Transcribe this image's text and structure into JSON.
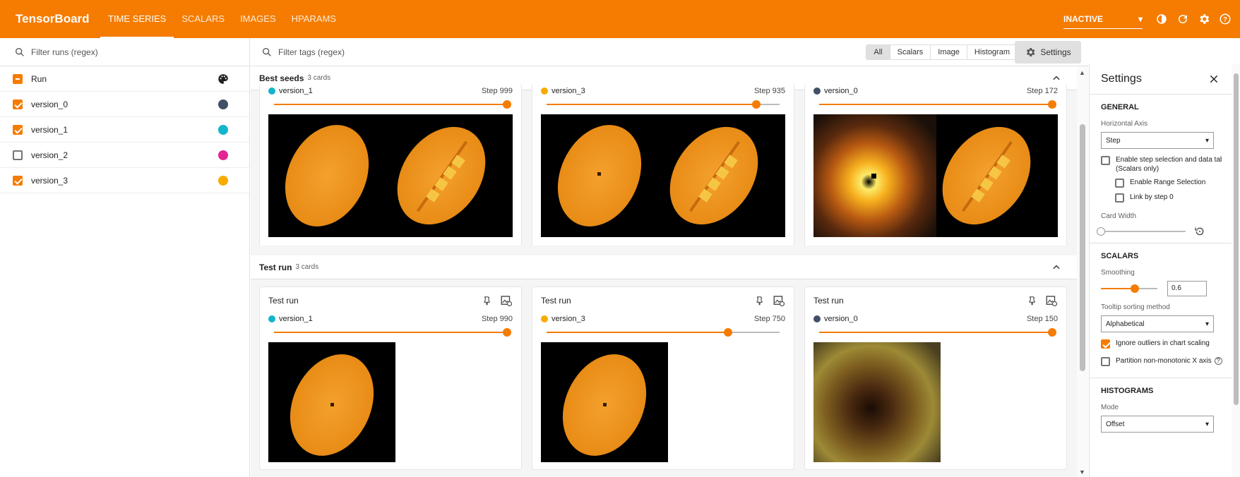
{
  "app": {
    "brand": "TensorBoard"
  },
  "nav": {
    "tabs": [
      "TIME SERIES",
      "SCALARS",
      "IMAGES",
      "HPARAMS"
    ],
    "active": "TIME SERIES"
  },
  "top": {
    "reload_state": "INACTIVE"
  },
  "runs": {
    "filter_placeholder": "Filter runs (regex)",
    "header": "Run",
    "items": [
      {
        "name": "version_0",
        "checked": true,
        "color": "#425066"
      },
      {
        "name": "version_1",
        "checked": true,
        "color": "#12b5cb"
      },
      {
        "name": "version_2",
        "checked": false,
        "color": "#e52592"
      },
      {
        "name": "version_3",
        "checked": true,
        "color": "#f9ab00"
      }
    ]
  },
  "main": {
    "filter_placeholder": "Filter tags (regex)",
    "type_filters": [
      "All",
      "Scalars",
      "Image",
      "Histogram"
    ],
    "active_type": "All",
    "settings_label": "Settings",
    "groups": [
      {
        "name": "Best seeds",
        "count": "3 cards",
        "cards": [
          {
            "run": "version_1",
            "color": "#12b5cb",
            "step": "Step 999",
            "slider": 1.0
          },
          {
            "run": "version_3",
            "color": "#f9ab00",
            "step": "Step 935",
            "slider": 0.9
          },
          {
            "run": "version_0",
            "color": "#425066",
            "step": "Step 172",
            "slider": 1.0
          }
        ]
      },
      {
        "name": "Test run",
        "count": "3 cards",
        "cards": [
          {
            "title": "Test run",
            "run": "version_1",
            "color": "#12b5cb",
            "step": "Step 990",
            "slider": 1.0
          },
          {
            "title": "Test run",
            "run": "version_3",
            "color": "#f9ab00",
            "step": "Step 750",
            "slider": 0.78
          },
          {
            "title": "Test run",
            "run": "version_0",
            "color": "#425066",
            "step": "Step 150",
            "slider": 1.0
          }
        ]
      }
    ]
  },
  "settings": {
    "title": "Settings",
    "general": {
      "title": "GENERAL",
      "horizontal_axis_label": "Horizontal Axis",
      "horizontal_axis_value": "Step",
      "enable_step_selection": "Enable step selection and data table",
      "scalars_only": "(Scalars only)",
      "enable_range": "Enable Range Selection",
      "link_step": "Link by step 0",
      "card_width_label": "Card Width"
    },
    "scalars": {
      "title": "SCALARS",
      "smoothing_label": "Smoothing",
      "smoothing_value": "0.6",
      "tooltip_label": "Tooltip sorting method",
      "tooltip_value": "Alphabetical",
      "ignore_outliers": "Ignore outliers in chart scaling",
      "partition": "Partition non-monotonic X axis"
    },
    "histograms": {
      "title": "HISTOGRAMS",
      "mode_label": "Mode",
      "mode_value": "Offset"
    }
  }
}
